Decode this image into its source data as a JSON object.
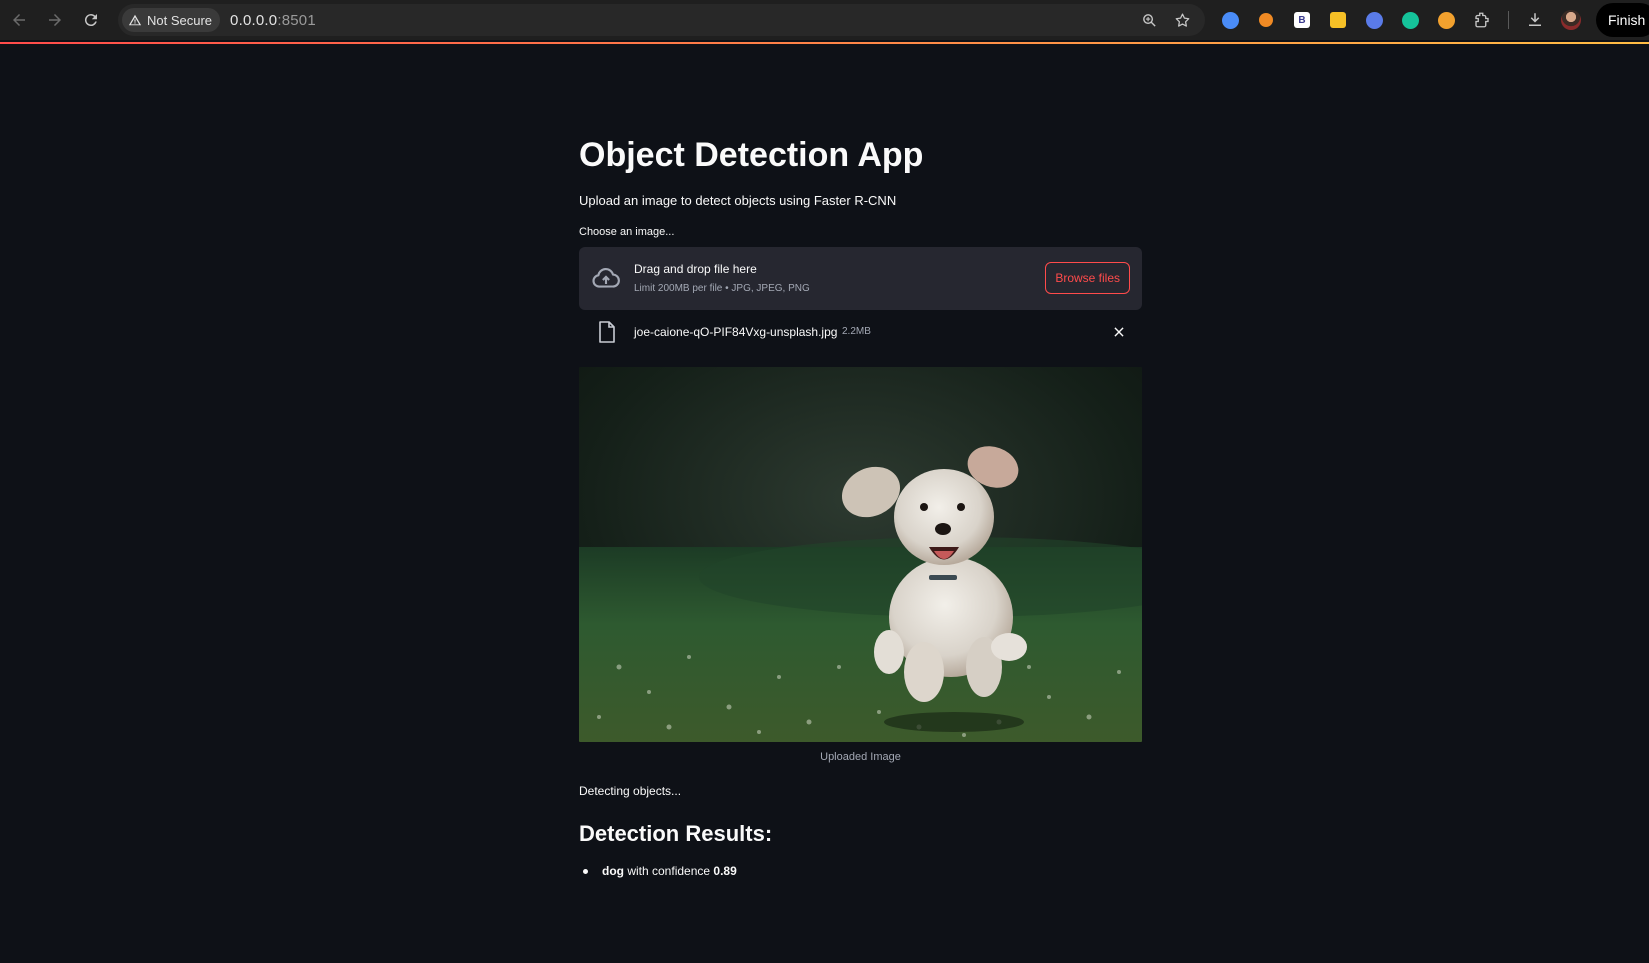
{
  "browser": {
    "security_label": "Not Secure",
    "url_host": "0.0.0.0",
    "url_port": ":8501",
    "finish_label": "Finish",
    "extensions": [
      {
        "name": "translate-extension-icon",
        "color": "#4a8cf7"
      },
      {
        "name": "person-check-extension-icon",
        "color": "#f08a24"
      },
      {
        "name": "b-extension-icon",
        "color": "#ffffff",
        "text": "B"
      },
      {
        "name": "note-extension-icon",
        "color": "#f6c026"
      },
      {
        "name": "shield-extension-icon",
        "color": "#5a7be8"
      },
      {
        "name": "grammarly-extension-icon",
        "color": "#15c39a"
      },
      {
        "name": "clock-extension-icon",
        "color": "#f2a12e"
      }
    ]
  },
  "app": {
    "title": "Object Detection App",
    "subtitle": "Upload an image to detect objects using Faster R-CNN",
    "uploader": {
      "label": "Choose an image...",
      "drop_title": "Drag and drop file here",
      "limit_text": "Limit 200MB per file • JPG, JPEG, PNG",
      "browse_label": "Browse files"
    },
    "file": {
      "name": "joe-caione-qO-PIF84Vxg-unsplash.jpg",
      "size": "2.2MB"
    },
    "image_caption": "Uploaded Image",
    "status_text": "Detecting objects...",
    "results_heading": "Detection Results:",
    "results": [
      {
        "label": "dog",
        "text": " with confidence ",
        "confidence": "0.89"
      }
    ]
  },
  "colors": {
    "background": "#0e1117",
    "accent": "#ff4b4b",
    "panel": "#262730"
  }
}
